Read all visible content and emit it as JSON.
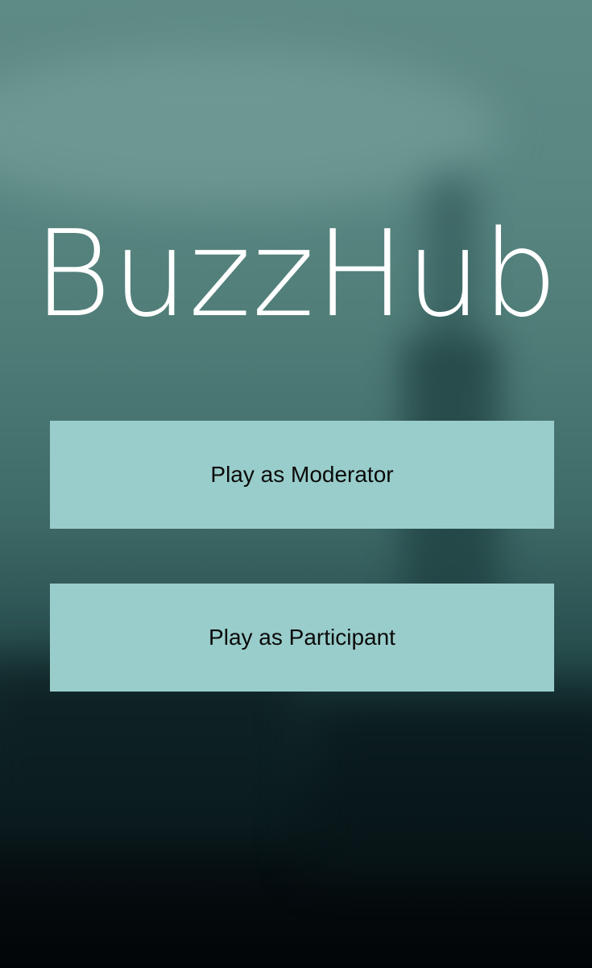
{
  "app": {
    "title": "BuzzHub"
  },
  "menu": {
    "moderator_label": "Play as Moderator",
    "participant_label": "Play as Participant"
  },
  "colors": {
    "button_background": "#99cdcb",
    "title_color": "#ffffff",
    "button_text": "#0a0a0a"
  }
}
